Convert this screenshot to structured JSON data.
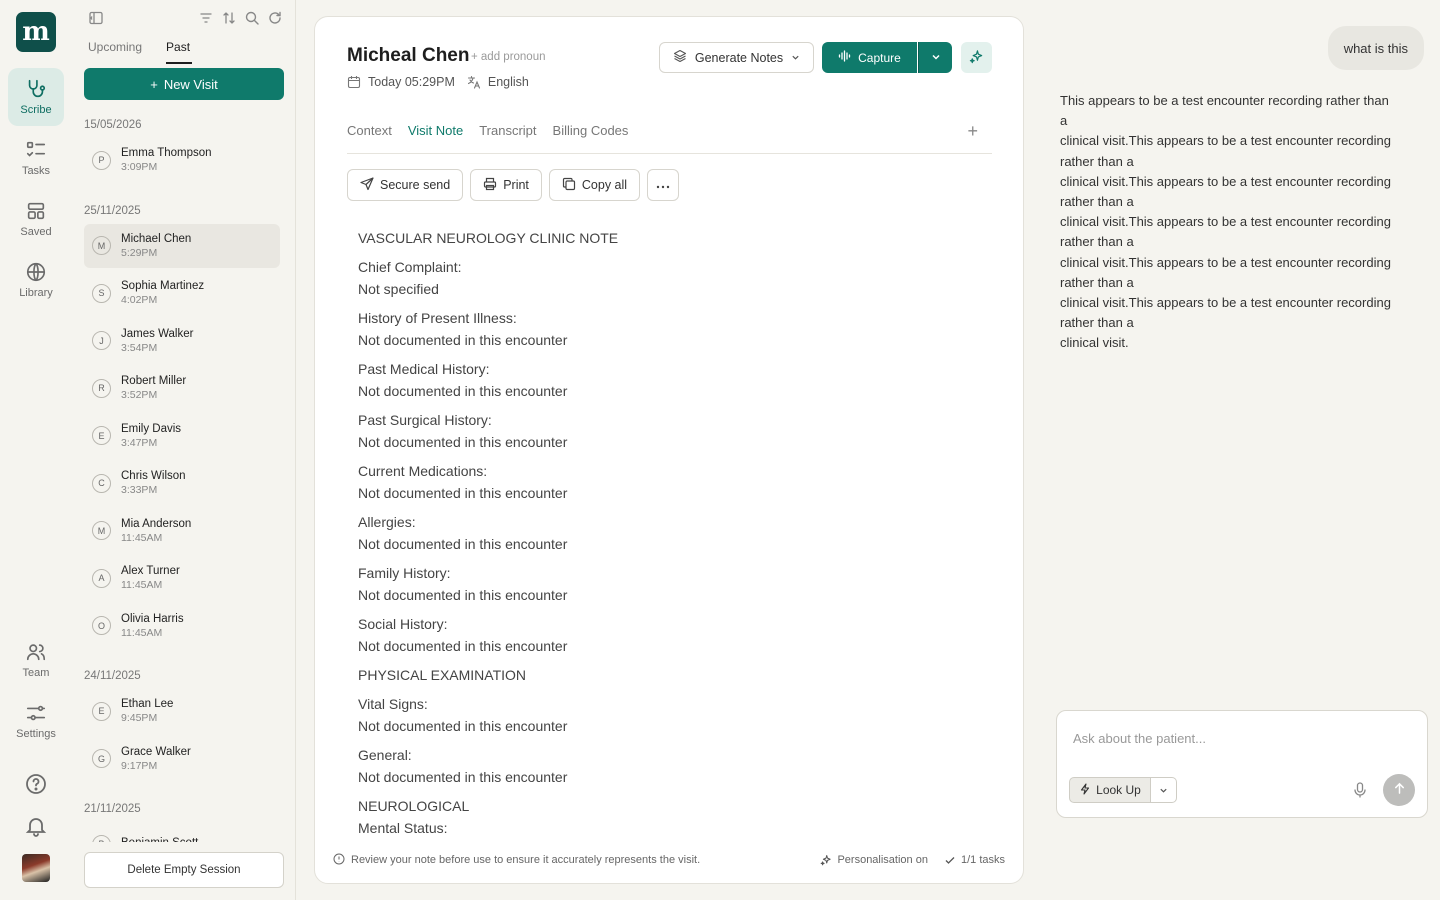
{
  "brand": {
    "logo_letter": "m",
    "accent": "#0f7a6b"
  },
  "rail": {
    "top": [
      {
        "label": "Scribe",
        "icon": "stethoscope-icon",
        "active": true
      },
      {
        "label": "Tasks",
        "icon": "checklist-icon"
      },
      {
        "label": "Saved",
        "icon": "layout-icon"
      },
      {
        "label": "Library",
        "icon": "globe-icon"
      }
    ],
    "bottom": [
      {
        "label": "Team",
        "icon": "users-icon"
      },
      {
        "label": "Settings",
        "icon": "sliders-icon"
      }
    ]
  },
  "sessions": {
    "tabs": [
      "Upcoming",
      "Past"
    ],
    "active_tab": "Past",
    "new_visit_label": "New Visit",
    "delete_label": "Delete Empty Session",
    "groups": [
      {
        "date": "15/05/2026",
        "items": [
          {
            "initial": "P",
            "name": "Emma Thompson",
            "time": "3:09PM"
          }
        ]
      },
      {
        "date": "25/11/2025",
        "items": [
          {
            "initial": "M",
            "name": "Michael Chen",
            "time": "5:29PM",
            "selected": true
          },
          {
            "initial": "S",
            "name": "Sophia Martinez",
            "time": "4:02PM"
          },
          {
            "initial": "J",
            "name": "James Walker",
            "time": "3:54PM"
          },
          {
            "initial": "R",
            "name": "Robert Miller",
            "time": "3:52PM"
          },
          {
            "initial": "E",
            "name": "Emily Davis",
            "time": "3:47PM"
          },
          {
            "initial": "C",
            "name": "Chris Wilson",
            "time": "3:33PM"
          },
          {
            "initial": "M",
            "name": "Mia Anderson",
            "time": "11:45AM"
          },
          {
            "initial": "A",
            "name": "Alex Turner",
            "time": "11:45AM"
          },
          {
            "initial": "O",
            "name": "Olivia Harris",
            "time": "11:45AM"
          }
        ]
      },
      {
        "date": "24/11/2025",
        "items": [
          {
            "initial": "E",
            "name": "Ethan Lee",
            "time": "9:45PM"
          },
          {
            "initial": "G",
            "name": "Grace Walker",
            "time": "9:17PM"
          }
        ]
      },
      {
        "date": "21/11/2025",
        "items": [
          {
            "initial": "B",
            "name": "Benjamin Scott",
            "time": ""
          }
        ]
      }
    ]
  },
  "note": {
    "patient_name": "Micheal Chen",
    "pronoun_label": "+ add pronoun",
    "date_label": "Today 05:29PM",
    "language": "English",
    "generate_label": "Generate Notes",
    "capture_label": "Capture",
    "tabs": [
      "Context",
      "Visit Note",
      "Transcript",
      "Billing Codes"
    ],
    "active_tab": "Visit Note",
    "actions": {
      "secure_send": "Secure send",
      "print": "Print",
      "copy_all": "Copy all"
    },
    "sections": [
      [
        "VASCULAR NEUROLOGY CLINIC NOTE"
      ],
      [
        "Chief Complaint:",
        "Not specified"
      ],
      [
        "History of Present Illness:",
        "Not documented in this encounter"
      ],
      [
        "Past Medical History:",
        "Not documented in this encounter"
      ],
      [
        "Past Surgical History:",
        "Not documented in this encounter"
      ],
      [
        "Current Medications:",
        "Not documented in this encounter"
      ],
      [
        "Allergies:",
        "Not documented in this encounter"
      ],
      [
        "Family History:",
        "Not documented in this encounter"
      ],
      [
        "Social History:",
        "Not documented in this encounter"
      ],
      [
        "PHYSICAL EXAMINATION"
      ],
      [
        "Vital Signs:",
        "Not documented in this encounter"
      ],
      [
        "General:",
        "Not documented in this encounter"
      ],
      [
        "NEUROLOGICAL",
        "Mental Status:"
      ]
    ],
    "footer": {
      "warning": "Review your note before use to ensure it accurately represents the visit.",
      "personalisation": "Personalisation on",
      "tasks": "1/1 tasks"
    }
  },
  "chat": {
    "user_message": "what is this",
    "ai_lines": [
      "This appears to be a test encounter recording rather than",
      "a",
      "clinical visit.This appears to be a test encounter recording",
      "rather than a",
      "clinical visit.This appears to be a test encounter recording",
      "rather than a",
      "clinical visit.This appears to be a test encounter recording",
      "rather than a",
      "clinical visit.This appears to be a test encounter recording",
      "rather than a",
      "clinical visit.This appears to be a test encounter recording",
      "rather than a",
      "clinical visit."
    ],
    "input_placeholder": "Ask about the patient...",
    "lookup_label": "Look Up"
  }
}
